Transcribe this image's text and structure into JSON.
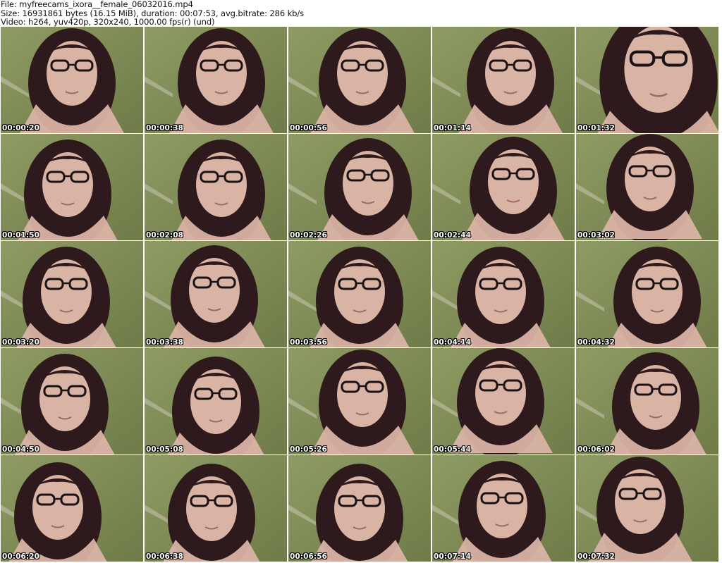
{
  "header": {
    "line1": "File: myfreecams_ixora__female_06032016.mp4",
    "line2": "Size: 16931861 bytes (16.15 MiB), duration: 00:07:53, avg.bitrate: 286 kb/s",
    "line3": "Video: h264, yuv420p, 320x240, 1000.00 fps(r) (und)"
  },
  "thumbnails": [
    {
      "timestamp": "00:00:20"
    },
    {
      "timestamp": "00:00:38"
    },
    {
      "timestamp": "00:00:56"
    },
    {
      "timestamp": "00:01:14"
    },
    {
      "timestamp": "00:01:32"
    },
    {
      "timestamp": "00:01:50"
    },
    {
      "timestamp": "00:02:08"
    },
    {
      "timestamp": "00:02:26"
    },
    {
      "timestamp": "00:02:44"
    },
    {
      "timestamp": "00:03:02"
    },
    {
      "timestamp": "00:03:20"
    },
    {
      "timestamp": "00:03:38"
    },
    {
      "timestamp": "00:03:56"
    },
    {
      "timestamp": "00:04:14"
    },
    {
      "timestamp": "00:04:32"
    },
    {
      "timestamp": "00:04:50"
    },
    {
      "timestamp": "00:05:08"
    },
    {
      "timestamp": "00:05:26"
    },
    {
      "timestamp": "00:05:44"
    },
    {
      "timestamp": "00:06:02"
    },
    {
      "timestamp": "00:06:20"
    },
    {
      "timestamp": "00:06:38"
    },
    {
      "timestamp": "00:06:56"
    },
    {
      "timestamp": "00:07:14"
    },
    {
      "timestamp": "00:07:32"
    }
  ],
  "colors": {
    "wall": "#8e9b64",
    "wall_dark": "#6f7b48",
    "hair": "#2e1a1c",
    "skin": "#d9b3a4",
    "glasses": "#1a1214"
  }
}
